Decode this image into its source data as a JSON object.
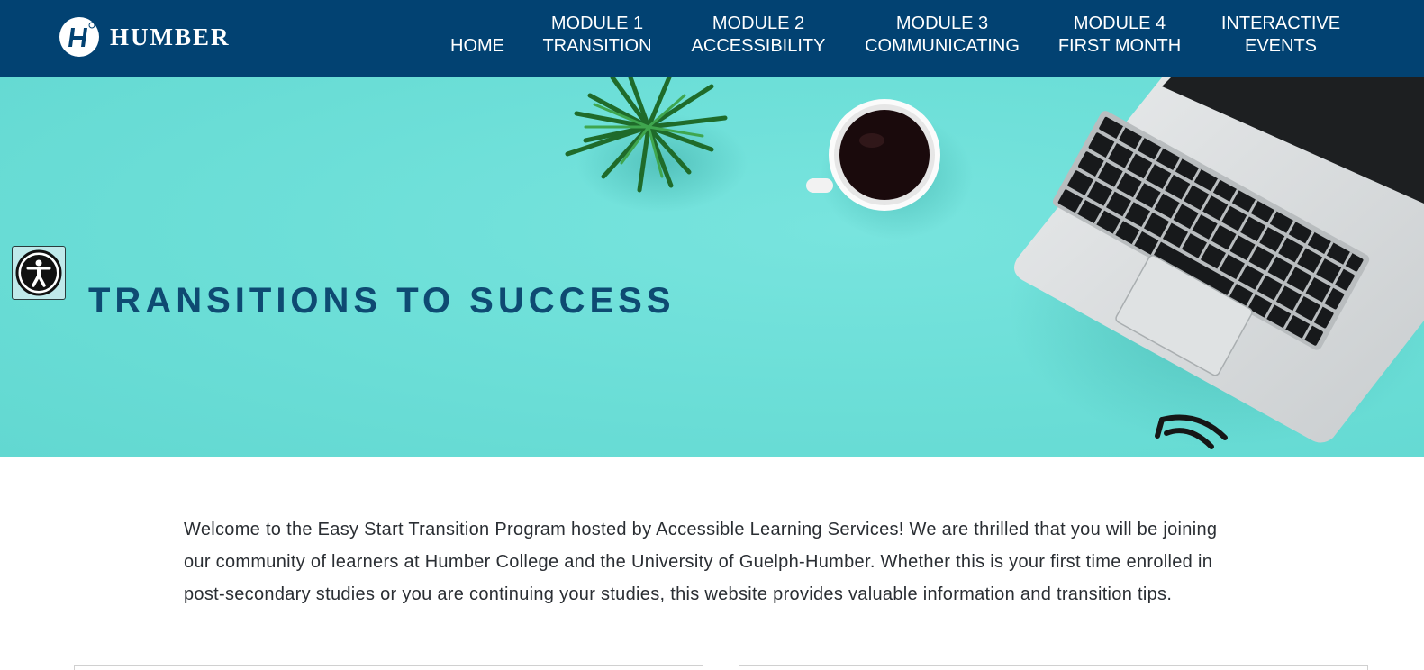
{
  "header": {
    "logo_text": "HUMBER",
    "nav": [
      {
        "line1": "HOME",
        "line2": ""
      },
      {
        "line1": "MODULE 1",
        "line2": "TRANSITION"
      },
      {
        "line1": "MODULE 2",
        "line2": "ACCESSIBILITY"
      },
      {
        "line1": "MODULE 3",
        "line2": "COMMUNICATING"
      },
      {
        "line1": "MODULE 4",
        "line2": "FIRST MONTH"
      },
      {
        "line1": "INTERACTIVE",
        "line2": "EVENTS"
      }
    ]
  },
  "hero": {
    "title": "TRANSITIONS TO SUCCESS",
    "background_color": "#6ddfd8"
  },
  "accessibility_button": {
    "icon": "accessibility-icon"
  },
  "content": {
    "intro": "Welcome to the Easy Start Transition Program hosted by Accessible Learning Services! We are thrilled that you will be joining our community of learners at Humber College and the University of Guelph-Humber. Whether this is your first time enrolled in post-secondary studies or you are continuing your studies, this website provides valuable information and transition tips."
  },
  "colors": {
    "header_bg": "#024272",
    "title_color": "#0e4a72",
    "text_color": "#2a2e33"
  }
}
